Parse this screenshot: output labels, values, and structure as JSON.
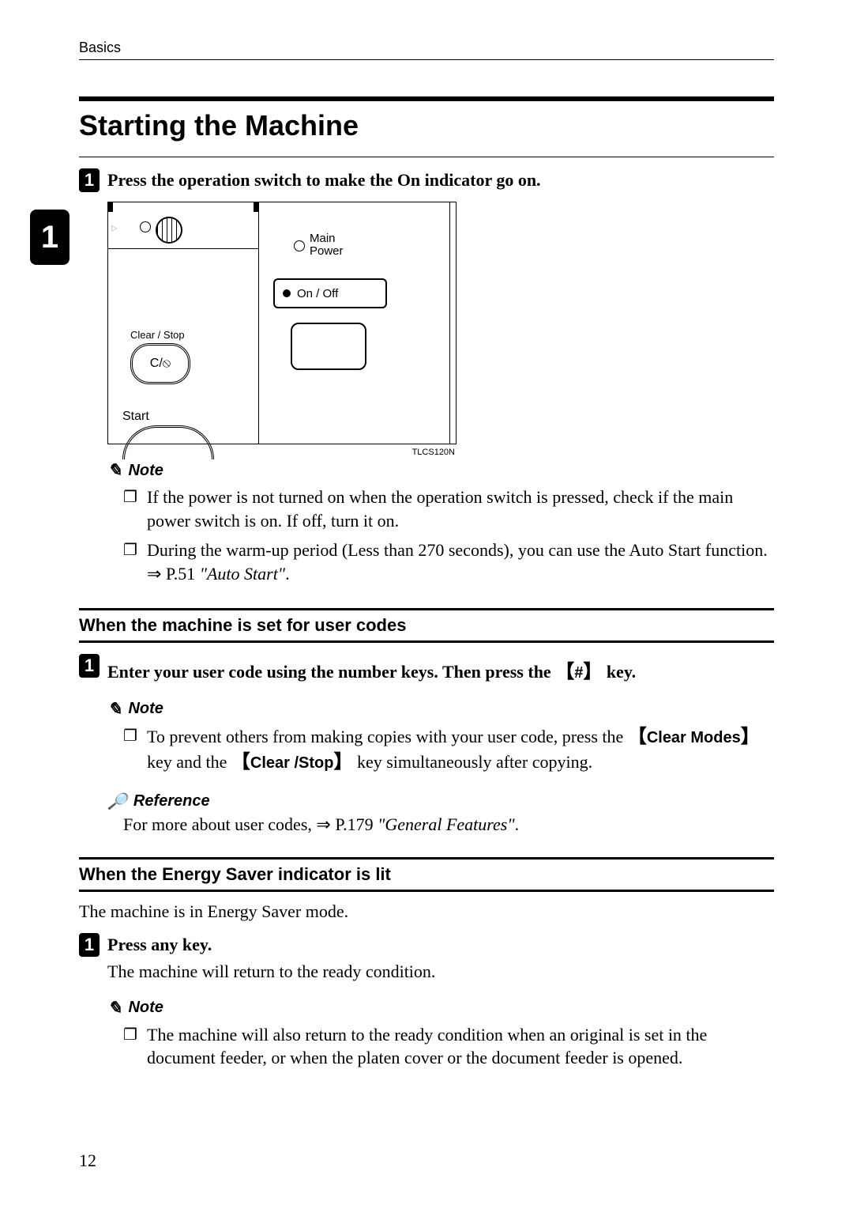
{
  "running_head": "Basics",
  "chapter_tab": "1",
  "title": "Starting the Machine",
  "step1": {
    "num": "1",
    "text": "Press the operation switch to make the On indicator go on."
  },
  "figure": {
    "main_power": "Main\nPower",
    "on_off": "On / Off",
    "clear_stop_label": "Clear / Stop",
    "clear_stop_btn": "C/",
    "start_label": "Start",
    "code": "TLCS120N"
  },
  "note_label": "Note",
  "notes1": {
    "a": "If the power is not turned on when the operation switch is pressed, check if the main power switch is on. If off, turn it on.",
    "b_pre": "During the warm-up period (Less than 270 seconds), you can use the Auto Start function. ",
    "b_arrow": "⇒",
    "b_ref": " P.51 ",
    "b_ital": "\"Auto Start\"",
    "b_post": "."
  },
  "sub_usercodes": "When the machine is set for user codes",
  "step2": {
    "num": "1",
    "pre": "Enter your user code using the number keys. Then press the ",
    "key": "#",
    "post": " key."
  },
  "notes2": {
    "pre": "To prevent others from making copies with your user code, press the ",
    "k1": "Clear Modes",
    "mid": " key and the ",
    "k2": "Clear /Stop",
    "post": " key simultaneously after copying."
  },
  "reference_label": "Reference",
  "reference": {
    "pre": "For more about user codes, ",
    "arrow": "⇒",
    "ref": " P.179 ",
    "ital": "\"General Features\"",
    "post": "."
  },
  "sub_energy": "When the Energy Saver indicator is lit",
  "energy_intro": "The machine is in Energy Saver mode.",
  "step3": {
    "num": "1",
    "text": "Press any key."
  },
  "energy_body": "The machine will return to the ready condition.",
  "notes3": {
    "a": "The machine will also return to the ready condition when an original is set in the document feeder, or when the platen cover or the document feeder is opened."
  },
  "page_number": "12"
}
